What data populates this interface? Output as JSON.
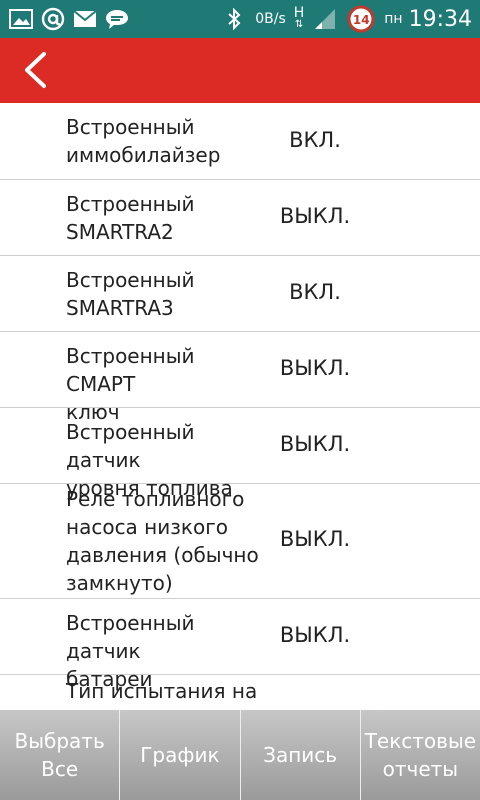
{
  "status_bar": {
    "speed": "0B/s",
    "network": "H",
    "badge": "14",
    "day": "пн",
    "time": "19:34",
    "bg_color": "#1f7a76"
  },
  "app_bar": {
    "bg_color": "#dc2b24",
    "back_icon": "chevron-left-icon"
  },
  "list": {
    "items": [
      {
        "label_line1": "Встроенный",
        "label_line2": "иммобилайзер",
        "value": "ВКЛ."
      },
      {
        "label_line1": "Встроенный",
        "label_line2": "SMARTRA2",
        "value": "ВЫКЛ."
      },
      {
        "label_line1": "Встроенный",
        "label_line2": "SMARTRA3",
        "value": "ВКЛ."
      },
      {
        "label_line1": "Встроенный СМАРТ",
        "label_line2": "ключ",
        "value": "ВЫКЛ."
      },
      {
        "label_line1": "Встроенный датчик",
        "label_line2": "уровня топлива",
        "value": "ВЫКЛ."
      },
      {
        "label_line1": "Реле топливного",
        "label_line2": "насоса низкого",
        "label_line3": "давления (обычно",
        "label_line4": "замкнуто)",
        "value": "ВЫКЛ."
      },
      {
        "label_line1": "Встроенный датчик",
        "label_line2": "батареи",
        "value": "ВЫКЛ."
      },
      {
        "label_line1": "Тип испытания на"
      }
    ]
  },
  "bottom_bar": {
    "select_all": "Выбрать Все",
    "graph": "График",
    "record": "Запись",
    "text_reports_line1": "Текстовые",
    "text_reports_line2": "отчеты"
  }
}
